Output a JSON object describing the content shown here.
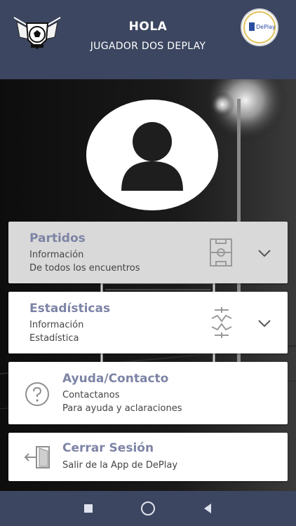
{
  "header": {
    "greeting": "HOLA",
    "subtitle": "JUGADOR DOS DEPLAY",
    "left_logo_icon": "soccer-ball-wings-logo",
    "right_logo_icon": "deplay-logo",
    "background_color": "#3c4660"
  },
  "profile": {
    "avatar_icon": "user-silhouette-icon"
  },
  "menu": {
    "accent_color": "#7d84a6",
    "items": [
      {
        "title": "Partidos",
        "line1": "Información",
        "line2": "De todos los encuentros",
        "icon": "soccer-field-icon",
        "action_icon": "chevron-down-icon",
        "active": true
      },
      {
        "title": "Estadísticas",
        "line1": "Información",
        "line2": "Estadística",
        "icon": "tactics-formation-icon",
        "action_icon": "chevron-down-icon",
        "active": false
      },
      {
        "title": "Ayuda/Contacto",
        "line1": "Contactanos",
        "line2": "Para ayuda y aclaraciones",
        "icon": "help-circle-icon",
        "active": false
      },
      {
        "title": "Cerrar Sesión",
        "line1": "Salir de la App de DePlay",
        "icon": "logout-door-icon",
        "active": false
      }
    ]
  },
  "system_nav": {
    "buttons": [
      "recent-apps-icon",
      "home-icon",
      "back-icon"
    ]
  }
}
